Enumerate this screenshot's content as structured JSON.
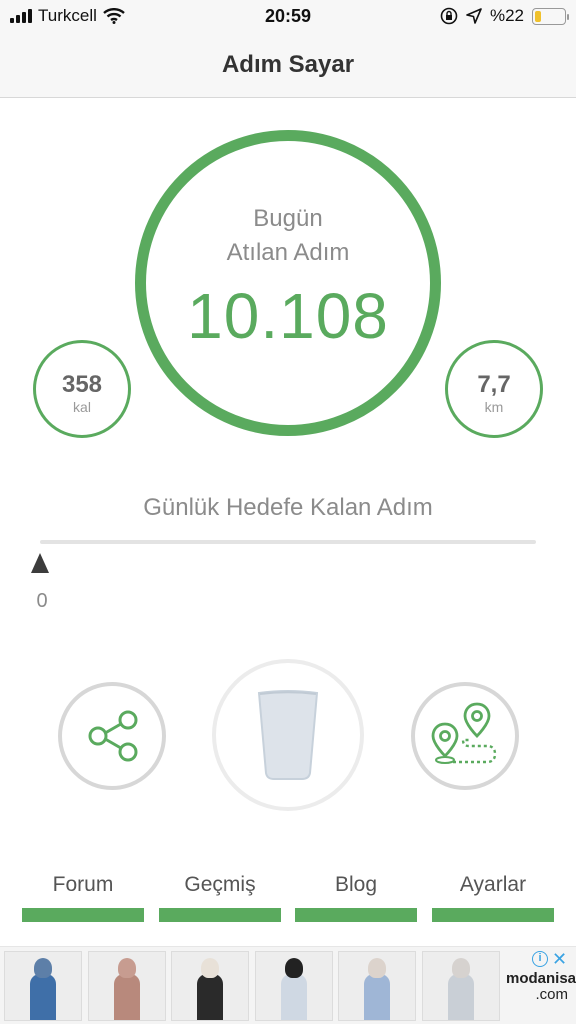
{
  "status_bar": {
    "carrier": "Turkcell",
    "time": "20:59",
    "battery_percent": "%22",
    "battery_level": 0.22,
    "battery_color": "#f0c12c",
    "icons": [
      "signal-bars-icon",
      "wifi-icon",
      "orientation-lock-icon",
      "location-arrow-icon",
      "battery-icon"
    ]
  },
  "nav": {
    "title": "Adım Sayar"
  },
  "today": {
    "line1": "Bugün",
    "line2": "Atılan Adım",
    "steps": "10.108"
  },
  "stats": {
    "calories": {
      "value": "358",
      "unit": "kal"
    },
    "distance": {
      "value": "7,7",
      "unit": "km"
    }
  },
  "goal": {
    "title": "Günlük Hedefe Kalan Adım",
    "remaining": "0"
  },
  "actions": {
    "share_icon": "share-icon",
    "water_icon": "water-glass-icon",
    "route_icon": "route-map-icon"
  },
  "tabs": [
    {
      "label": "Forum"
    },
    {
      "label": "Geçmiş"
    },
    {
      "label": "Blog"
    },
    {
      "label": "Ayarlar"
    }
  ],
  "ad": {
    "brand_line1": "modanisa",
    "brand_line2": ".com",
    "info_icon": "info-icon",
    "close_icon": "close-icon"
  },
  "colors": {
    "accent": "#5aaa5e",
    "text_muted": "#8b8b8b",
    "ad_link": "#3aa3e3"
  }
}
